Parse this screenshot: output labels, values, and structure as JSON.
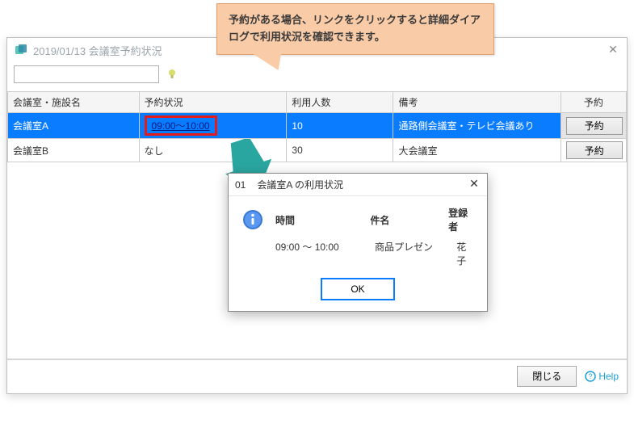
{
  "window": {
    "title": "2019/01/13 会議室予約状況",
    "close_glyph": "✕"
  },
  "search": {
    "value": "",
    "hint_name": "hint"
  },
  "table": {
    "headers": {
      "name": "会議室・施設名",
      "status": "予約状況",
      "capacity": "利用人数",
      "note": "備考",
      "action": "予約"
    },
    "rows": [
      {
        "name": "会議室A",
        "status": "09:00～10:00",
        "status_is_link": true,
        "capacity": "10",
        "note": "通路側会議室・テレビ会議あり",
        "action_label": "予約",
        "selected": true,
        "highlight_status": true
      },
      {
        "name": "会議室B",
        "status": "なし",
        "status_is_link": false,
        "capacity": "30",
        "note": "大会議室",
        "action_label": "予約",
        "selected": false,
        "highlight_status": false
      }
    ]
  },
  "footer": {
    "close_label": "閉じる",
    "help_label": "Help"
  },
  "callout": {
    "text": "予約がある場合、リンクをクリックすると詳細ダイアログで利用状況を確認できます。"
  },
  "modal": {
    "title_prefix": "01",
    "title": "会議室A の利用状況",
    "close_glyph": "✕",
    "headers": {
      "time": "時間",
      "subject": "件名",
      "user": "登録者"
    },
    "data": {
      "time": "09:00 ～ 10:00",
      "subject": "商品プレゼン",
      "user": "花子"
    },
    "ok_label": "OK"
  }
}
